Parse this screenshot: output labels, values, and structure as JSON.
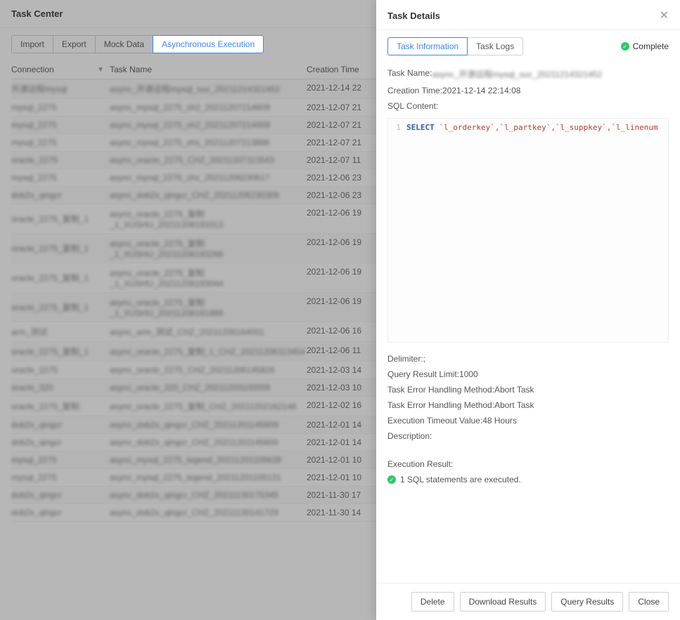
{
  "header": {
    "title": "Task Center"
  },
  "tabs": {
    "import": "Import",
    "export": "Export",
    "mock": "Mock Data",
    "async": "Asynchronous Execution"
  },
  "table": {
    "col_connection": "Connection",
    "col_taskname": "Task Name",
    "col_creation": "Creation Time",
    "rows": [
      {
        "conn": "开源远程mysql",
        "name": "async_开源远程mysql_suc_20211214321452",
        "time": "2021-12-14 22"
      },
      {
        "conn": "mysql_2275",
        "name": "async_mysql_2275_sh2_20211207214609",
        "time": "2021-12-07 21"
      },
      {
        "conn": "mysql_2275",
        "name": "async_mysql_2275_sh2_20211207214009",
        "time": "2021-12-07 21"
      },
      {
        "conn": "mysql_2275",
        "name": "async_mysql_2275_shs_20211207213866",
        "time": "2021-12-07 21"
      },
      {
        "conn": "oracle_2275",
        "name": "async_oracle_2275_CHZ_20211207113543",
        "time": "2021-12-07 11"
      },
      {
        "conn": "mysql_2275",
        "name": "async_mysql_2275_chz_20211206230617",
        "time": "2021-12-06 23"
      },
      {
        "conn": "dob2x_qingcr",
        "name": "async_dob2x_qingcr_CHZ_20211206230309",
        "time": "2021-12-06 23"
      },
      {
        "conn": "oracle_2275_复制_1",
        "name": "async_oracle_2275_复制_1_XUSHU_20211206193313",
        "time": "2021-12-06 19"
      },
      {
        "conn": "oracle_2275_复制_1",
        "name": "async_oracle_2275_复制_1_XUSHU_20211206193266",
        "time": "2021-12-06 19"
      },
      {
        "conn": "oracle_2275_复制_1",
        "name": "async_oracle_2275_复制_1_XUSHU_20211206193044",
        "time": "2021-12-06 19"
      },
      {
        "conn": "oracle_2275_复制_1",
        "name": "async_oracle_2275_复制_1_XUSHU_20211206191999",
        "time": "2021-12-06 19"
      },
      {
        "conn": "arm_测试",
        "name": "async_arm_测试_CHZ_20211206164001",
        "time": "2021-12-06 16"
      },
      {
        "conn": "oracle_2275_复制_1",
        "name": "async_oracle_2275_复制_1_CHZ_20211206113454",
        "time": "2021-12-06 11"
      },
      {
        "conn": "oracle_2275",
        "name": "async_oracle_2275_CHZ_20211206145826",
        "time": "2021-12-03 14"
      },
      {
        "conn": "oracle_320",
        "name": "async_oracle_320_CHZ_20211203100059",
        "time": "2021-12-03 10"
      },
      {
        "conn": "oracle_2275_复制",
        "name": "async_oracle_2275_复制_CHZ_20211202162148",
        "time": "2021-12-02 16"
      },
      {
        "conn": "dob2x_qingcr",
        "name": "async_dob2x_qingcr_CHZ_20211201145609",
        "time": "2021-12-01 14"
      },
      {
        "conn": "dob2x_qingcr",
        "name": "async_dob2x_qingcr_CHZ_20211201145600",
        "time": "2021-12-01 14"
      },
      {
        "conn": "mysql_2275",
        "name": "async_mysql_2275_legend_20211201105639",
        "time": "2021-12-01 10"
      },
      {
        "conn": "mysql_2275",
        "name": "async_mysql_2275_legend_20211201105131",
        "time": "2021-12-01 10"
      },
      {
        "conn": "dob2x_qingcr",
        "name": "async_dob2x_qingcr_CHZ_20211130175345",
        "time": "2021-11-30 17"
      },
      {
        "conn": "dob2x_qingcr",
        "name": "async_dob2x_qingcr_CHZ_20211130141729",
        "time": "2021-11-30 14"
      }
    ]
  },
  "panel": {
    "title": "Task Details",
    "tab_info": "Task Information",
    "tab_logs": "Task Logs",
    "status": "Complete",
    "info": {
      "taskname_label": "Task Name:",
      "taskname_value": "async_开源远程mysql_suc_20211214321452",
      "creation_label": "Creation Time:",
      "creation_value": "2021-12-14 22:14:08",
      "sql_label": "SQL Content:",
      "sql_keyword": "SELECT",
      "sql_cols": " `l_orderkey`,`l_partkey`,`l_suppkey`,`l_linenum",
      "delimiter_label": "Delimiter:",
      "delimiter_value": ";",
      "qrlimit_label": "Query Result Limit:",
      "qrlimit_value": "1000",
      "errh1_label": "Task Error Handling Method:",
      "errh1_value": "Abort Task",
      "errh2_label": "Task Error Handling Method:",
      "errh2_value": "Abort Task",
      "timeout_label": "Execution Timeout Value:",
      "timeout_value": "48 Hours",
      "desc_label": "Description:",
      "exec_label": "Execution Result:",
      "exec_stmt": "1 SQL statements are executed."
    },
    "footer": {
      "delete": "Delete",
      "download": "Download Results",
      "query": "Query Results",
      "close": "Close"
    }
  }
}
